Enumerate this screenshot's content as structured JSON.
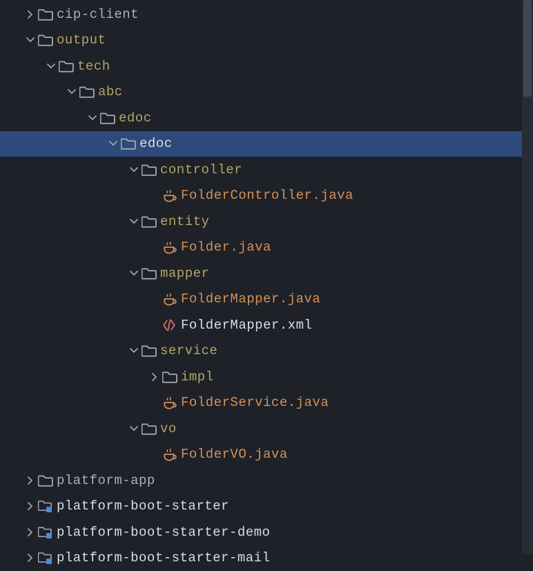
{
  "tree": [
    {
      "depth": 1,
      "expand": "closed",
      "icon": "folder",
      "label": "cip-client",
      "colorClass": "color-gray",
      "selected": false
    },
    {
      "depth": 1,
      "expand": "open",
      "icon": "folder",
      "label": "output",
      "colorClass": "color-khaki",
      "selected": false
    },
    {
      "depth": 2,
      "expand": "open",
      "icon": "folder",
      "label": "tech",
      "colorClass": "color-khaki",
      "selected": false
    },
    {
      "depth": 3,
      "expand": "open",
      "icon": "folder",
      "label": "abc",
      "colorClass": "color-khaki",
      "selected": false
    },
    {
      "depth": 4,
      "expand": "open",
      "icon": "folder",
      "label": "edoc",
      "colorClass": "color-khaki",
      "selected": false
    },
    {
      "depth": 5,
      "expand": "open",
      "icon": "folder",
      "label": "edoc",
      "colorClass": "color-white",
      "selected": true
    },
    {
      "depth": 6,
      "expand": "open",
      "icon": "folder",
      "label": "controller",
      "colorClass": "color-khaki",
      "selected": false
    },
    {
      "depth": 7,
      "expand": "none",
      "icon": "java",
      "label": "FolderController.java",
      "colorClass": "color-orange",
      "selected": false
    },
    {
      "depth": 6,
      "expand": "open",
      "icon": "folder",
      "label": "entity",
      "colorClass": "color-khaki",
      "selected": false
    },
    {
      "depth": 7,
      "expand": "none",
      "icon": "java",
      "label": "Folder.java",
      "colorClass": "color-orange",
      "selected": false
    },
    {
      "depth": 6,
      "expand": "open",
      "icon": "folder",
      "label": "mapper",
      "colorClass": "color-khaki",
      "selected": false
    },
    {
      "depth": 7,
      "expand": "none",
      "icon": "java",
      "label": "FolderMapper.java",
      "colorClass": "color-orange",
      "selected": false
    },
    {
      "depth": 7,
      "expand": "none",
      "icon": "xml",
      "label": "FolderMapper.xml",
      "colorClass": "color-white",
      "selected": false
    },
    {
      "depth": 6,
      "expand": "open",
      "icon": "folder",
      "label": "service",
      "colorClass": "color-khaki",
      "selected": false
    },
    {
      "depth": 7,
      "expand": "closed",
      "icon": "folder",
      "label": "impl",
      "colorClass": "color-khaki",
      "selected": false
    },
    {
      "depth": 7,
      "expand": "none",
      "icon": "java",
      "label": "FolderService.java",
      "colorClass": "color-orange",
      "selected": false
    },
    {
      "depth": 6,
      "expand": "open",
      "icon": "folder",
      "label": "vo",
      "colorClass": "color-khaki",
      "selected": false
    },
    {
      "depth": 7,
      "expand": "none",
      "icon": "java",
      "label": "FolderVO.java",
      "colorClass": "color-orange",
      "selected": false
    },
    {
      "depth": 1,
      "expand": "closed",
      "icon": "folder",
      "label": "platform-app",
      "colorClass": "color-gray",
      "selected": false
    },
    {
      "depth": 1,
      "expand": "closed",
      "icon": "module",
      "label": "platform-boot-starter",
      "colorClass": "color-white",
      "selected": false
    },
    {
      "depth": 1,
      "expand": "closed",
      "icon": "module",
      "label": "platform-boot-starter-demo",
      "colorClass": "color-white",
      "selected": false
    },
    {
      "depth": 1,
      "expand": "closed",
      "icon": "module",
      "label": "platform-boot-starter-mail",
      "colorClass": "color-white",
      "selected": false
    }
  ],
  "indentUnit": 30
}
